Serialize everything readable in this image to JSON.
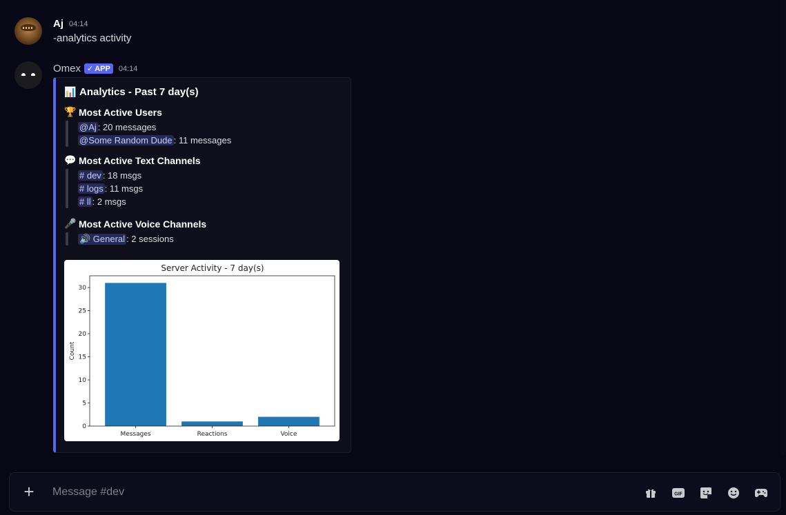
{
  "messages": [
    {
      "author": "Aj",
      "time": "04:14",
      "text": "-analytics activity"
    },
    {
      "author": "Omex",
      "badge": "APP",
      "time": "04:14"
    }
  ],
  "embed": {
    "accent_color": "#5865f2",
    "title": "Analytics - Past 7 day(s)",
    "title_icon": "bar-chart-emoji",
    "fields": {
      "users": {
        "name": "Most Active Users",
        "icon": "trophy-emoji",
        "lines": [
          {
            "mention": "@Aj",
            "rest": ": 20 messages"
          },
          {
            "mention": "@Some Random Dude",
            "rest": ": 11 messages"
          }
        ]
      },
      "text_channels": {
        "name": "Most Active Text Channels",
        "icon": "speech-bubble-emoji",
        "lines": [
          {
            "mention": "# dev",
            "rest": ": 18 msgs"
          },
          {
            "mention": "# logs",
            "rest": ": 11 msgs"
          },
          {
            "mention": "# ll",
            "rest": ": 2 msgs"
          }
        ]
      },
      "voice_channels": {
        "name": "Most Active Voice Channels",
        "icon": "microphone-emoji",
        "lines": [
          {
            "mention": "🔊 General",
            "rest": ": 2 sessions"
          }
        ]
      }
    }
  },
  "chart_data": {
    "type": "bar",
    "title": "Server Activity - 7 day(s)",
    "xlabel": "",
    "ylabel": "Count",
    "categories": [
      "Messages",
      "Reactions",
      "Voice"
    ],
    "values": [
      31,
      1,
      2
    ],
    "ylim": [
      0,
      32.55
    ],
    "yticks": [
      0,
      5,
      10,
      15,
      20,
      25,
      30
    ],
    "bar_color": "#1f77b4",
    "grid": false
  },
  "composer": {
    "placeholder": "Message #dev",
    "icons": [
      "gift-icon",
      "gif-icon",
      "sticker-icon",
      "emoji-icon",
      "gamepad-icon"
    ]
  }
}
